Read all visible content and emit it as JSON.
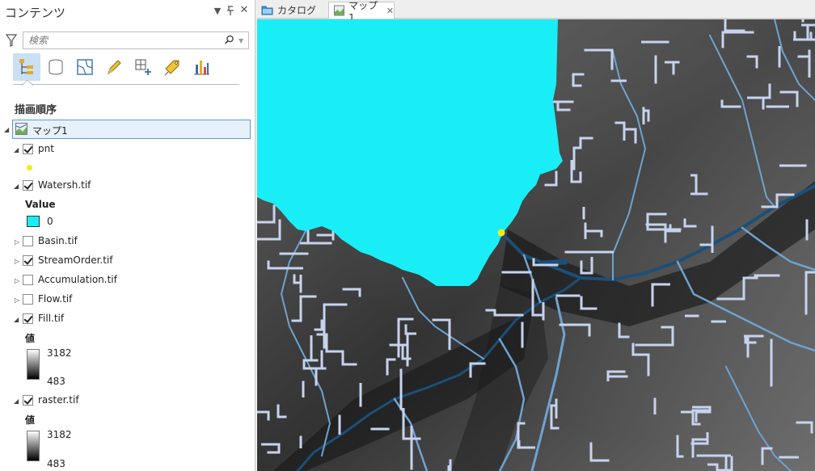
{
  "contents_pane": {
    "title": "コンテンツ",
    "search_placeholder": "検索",
    "section_title": "描画順序",
    "map_name": "マップ1",
    "layers": [
      {
        "name": "pnt",
        "checked": true,
        "expanded": true
      },
      {
        "name": "Watersh.tif",
        "checked": true,
        "expanded": true,
        "legend_title": "Value",
        "legend_value": "0",
        "legend_color": "#19eef7"
      },
      {
        "name": "Basin.tif",
        "checked": false,
        "expanded": false
      },
      {
        "name": "StreamOrder.tif",
        "checked": true,
        "expanded": false
      },
      {
        "name": "Accumulation.tif",
        "checked": false,
        "expanded": false
      },
      {
        "name": "Flow.tif",
        "checked": false,
        "expanded": false
      },
      {
        "name": "Fill.tif",
        "checked": true,
        "expanded": true,
        "legend_title": "値",
        "legend_high": "3182",
        "legend_low": "483"
      },
      {
        "name": "raster.tif",
        "checked": true,
        "expanded": true,
        "legend_title": "値",
        "legend_high": "3182",
        "legend_low": "483"
      }
    ],
    "point_color": "#f4ea1a"
  },
  "tabs": [
    {
      "label": "カタログ",
      "active": false
    },
    {
      "label": "マップ1",
      "active": true
    }
  ],
  "colors": {
    "watershed": "#19eef7",
    "stream_light": "#c7d3ee",
    "stream_mid": "#6ea3cf",
    "stream_dark": "#1c4f78",
    "selection": "#5a9ad6"
  }
}
